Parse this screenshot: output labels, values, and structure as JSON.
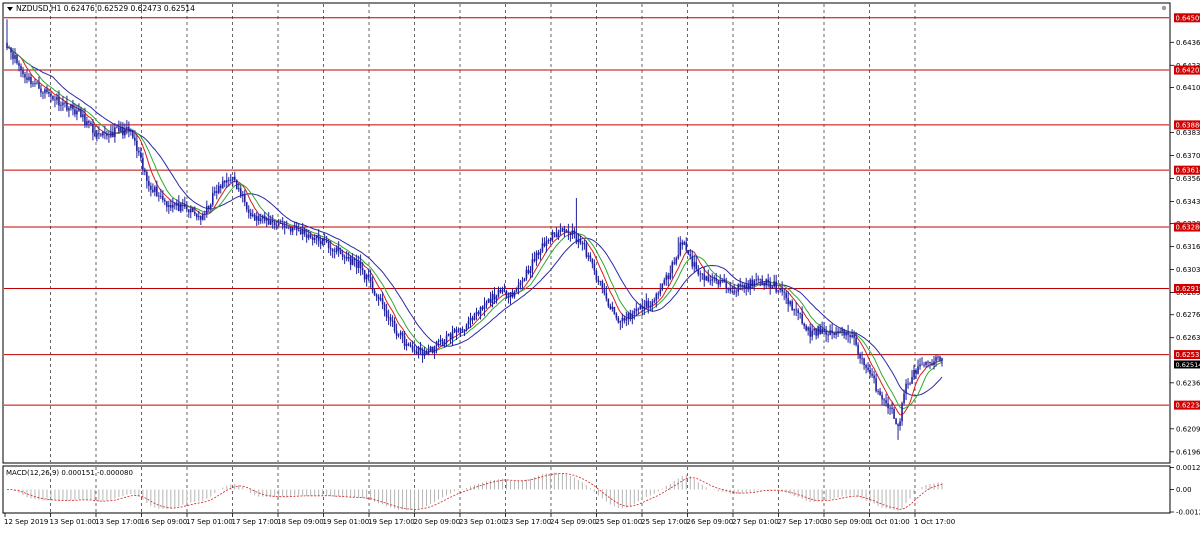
{
  "chart_data": [
    {
      "type": "candlestick",
      "symbol_header": "NZDUSD,H1  0.62476 0.62529 0.62473 0.62514",
      "ylim": [
        0.619,
        0.6459
      ],
      "price_ticks": [
        "0.64365",
        "0.64230",
        "0.64100",
        "0.63835",
        "0.63700",
        "0.63565",
        "0.63430",
        "0.63300",
        "0.63165",
        "0.63030",
        "0.62895",
        "0.62765",
        "0.62630",
        "0.62365",
        "0.62095",
        "0.61960"
      ],
      "horizontal_levels": [
        "0.64509",
        "0.64202",
        "0.63880",
        "0.63614",
        "0.63280",
        "0.62919",
        "0.62531",
        "0.62234"
      ],
      "current_price": "0.62514",
      "time_labels": [
        "12 Sep 2019",
        "13 Sep 01:00",
        "13 Sep 17:00",
        "16 Sep 09:00",
        "17 Sep 01:00",
        "17 Sep 17:00",
        "18 Sep 09:00",
        "19 Sep 01:00",
        "19 Sep 17:00",
        "20 Sep 09:00",
        "23 Sep 01:00",
        "23 Sep 17:00",
        "24 Sep 09:00",
        "25 Sep 01:00",
        "25 Sep 17:00",
        "26 Sep 09:00",
        "27 Sep 01:00",
        "27 Sep 17:00",
        "30 Sep 09:00",
        "1 Oct 01:00",
        "1 Oct 17:00"
      ],
      "close_anchors": [
        [
          0,
          0.6436
        ],
        [
          8,
          0.6418
        ],
        [
          16,
          0.641
        ],
        [
          26,
          0.6402
        ],
        [
          36,
          0.6395
        ],
        [
          46,
          0.638
        ],
        [
          56,
          0.6385
        ],
        [
          62,
          0.6384
        ],
        [
          70,
          0.6355
        ],
        [
          80,
          0.6342
        ],
        [
          90,
          0.6338
        ],
        [
          98,
          0.6333
        ],
        [
          104,
          0.6348
        ],
        [
          112,
          0.6358
        ],
        [
          118,
          0.6345
        ],
        [
          124,
          0.6333
        ],
        [
          136,
          0.633
        ],
        [
          148,
          0.6325
        ],
        [
          160,
          0.6318
        ],
        [
          168,
          0.6311
        ],
        [
          176,
          0.6306
        ],
        [
          184,
          0.629
        ],
        [
          194,
          0.6268
        ],
        [
          202,
          0.6256
        ],
        [
          210,
          0.6254
        ],
        [
          220,
          0.6263
        ],
        [
          232,
          0.6272
        ],
        [
          244,
          0.6288
        ],
        [
          254,
          0.629
        ],
        [
          262,
          0.6305
        ],
        [
          270,
          0.632
        ],
        [
          280,
          0.6328
        ],
        [
          288,
          0.6318
        ],
        [
          294,
          0.6302
        ],
        [
          300,
          0.6285
        ],
        [
          306,
          0.6272
        ],
        [
          314,
          0.6278
        ],
        [
          324,
          0.6285
        ],
        [
          332,
          0.6302
        ],
        [
          338,
          0.632
        ],
        [
          344,
          0.6305
        ],
        [
          350,
          0.6298
        ],
        [
          356,
          0.6295
        ],
        [
          366,
          0.6292
        ],
        [
          376,
          0.6296
        ],
        [
          384,
          0.6294
        ],
        [
          394,
          0.628
        ],
        [
          402,
          0.6265
        ],
        [
          408,
          0.6268
        ],
        [
          414,
          0.6265
        ],
        [
          422,
          0.6266
        ],
        [
          428,
          0.625
        ],
        [
          436,
          0.6232
        ],
        [
          442,
          0.6222
        ],
        [
          446,
          0.621
        ],
        [
          450,
          0.6235
        ],
        [
          456,
          0.6245
        ],
        [
          462,
          0.6247
        ],
        [
          468,
          0.6251
        ]
      ],
      "series": [
        {
          "name": "",
          "color": "#2a2aa6",
          "ma_period": 24
        },
        {
          "name": "",
          "color": "#d81e1e",
          "ma_period": 8
        },
        {
          "name": "",
          "color": "#2fa82f",
          "ma_period": 13
        }
      ],
      "legend": "none",
      "grid": true
    },
    {
      "type": "bar",
      "title": "MACD(12,26,9) 0.000151 -0.000080",
      "ylim": [
        -0.00125,
        0.00125
      ],
      "ticks": [
        "0.00122",
        "0.00",
        "-0.00125"
      ],
      "series": [
        {
          "name": "",
          "color": "#b5b5b5"
        },
        {
          "name": "",
          "color": "#d81e1e"
        }
      ]
    }
  ],
  "colors": {
    "background": "#ffffff",
    "grid": "#000000",
    "level_line": "#c00000",
    "label_fill": "#d10000",
    "candle": "#20209a",
    "axis_text": "#000000"
  },
  "icons": [
    "down-triangle-icon",
    "gear-icon"
  ]
}
